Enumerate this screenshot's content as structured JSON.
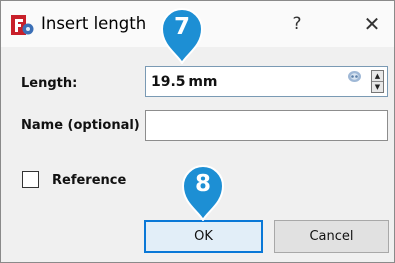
{
  "dialog": {
    "title": "Insert length",
    "app_icon": "freecad-sketcher-icon",
    "help_label": "?",
    "close_label": "✕"
  },
  "form": {
    "length_label": "Length:",
    "length_value": "19.5 mm",
    "length_expression_icon": "expression-link-icon",
    "name_label": "Name (optional)",
    "name_value": "",
    "reference_label": "Reference",
    "reference_checked": false
  },
  "buttons": {
    "ok_label": "OK",
    "cancel_label": "Cancel"
  },
  "annotations": {
    "step_7": "7",
    "step_8": "8"
  },
  "colors": {
    "badge": "#1d8fd4",
    "ok_border": "#0a78d7",
    "icon_red": "#c8202a"
  }
}
